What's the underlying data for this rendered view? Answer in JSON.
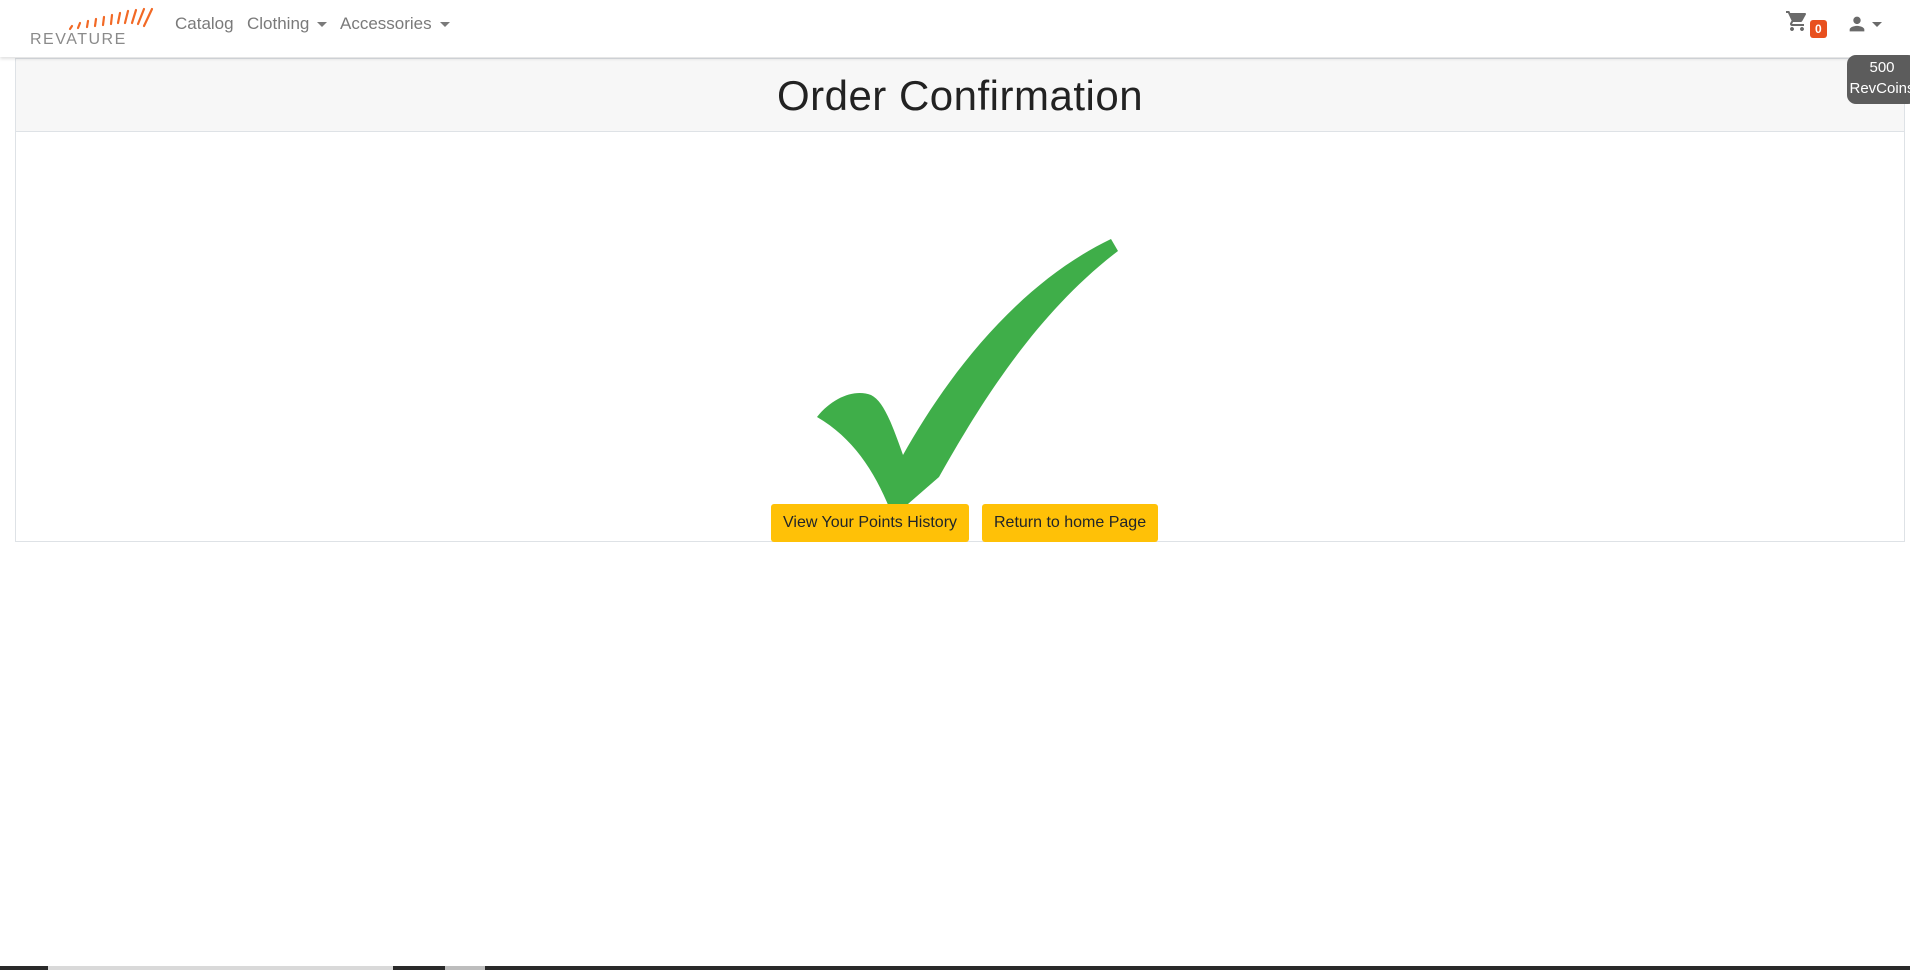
{
  "brand": {
    "name": "REVATURE",
    "accent_color": "#f26925"
  },
  "nav": {
    "items": [
      {
        "label": "Catalog",
        "has_dropdown": false
      },
      {
        "label": "Clothing",
        "has_dropdown": true
      },
      {
        "label": "Accessories",
        "has_dropdown": true
      }
    ]
  },
  "header_right": {
    "cart_icon": "shopping-cart-icon",
    "cart_count": "0",
    "cart_badge_color": "#e8501e",
    "user_icon": "user-icon",
    "coins": {
      "amount": "500",
      "unit": "RevCoins"
    }
  },
  "main": {
    "title": "Order Confirmation",
    "status_icon": "checkmark-icon",
    "status_color": "#3fae49",
    "buttons": {
      "points_history": "View Your Points History",
      "return_home": "Return to home Page"
    },
    "button_color": "#ffc107"
  }
}
